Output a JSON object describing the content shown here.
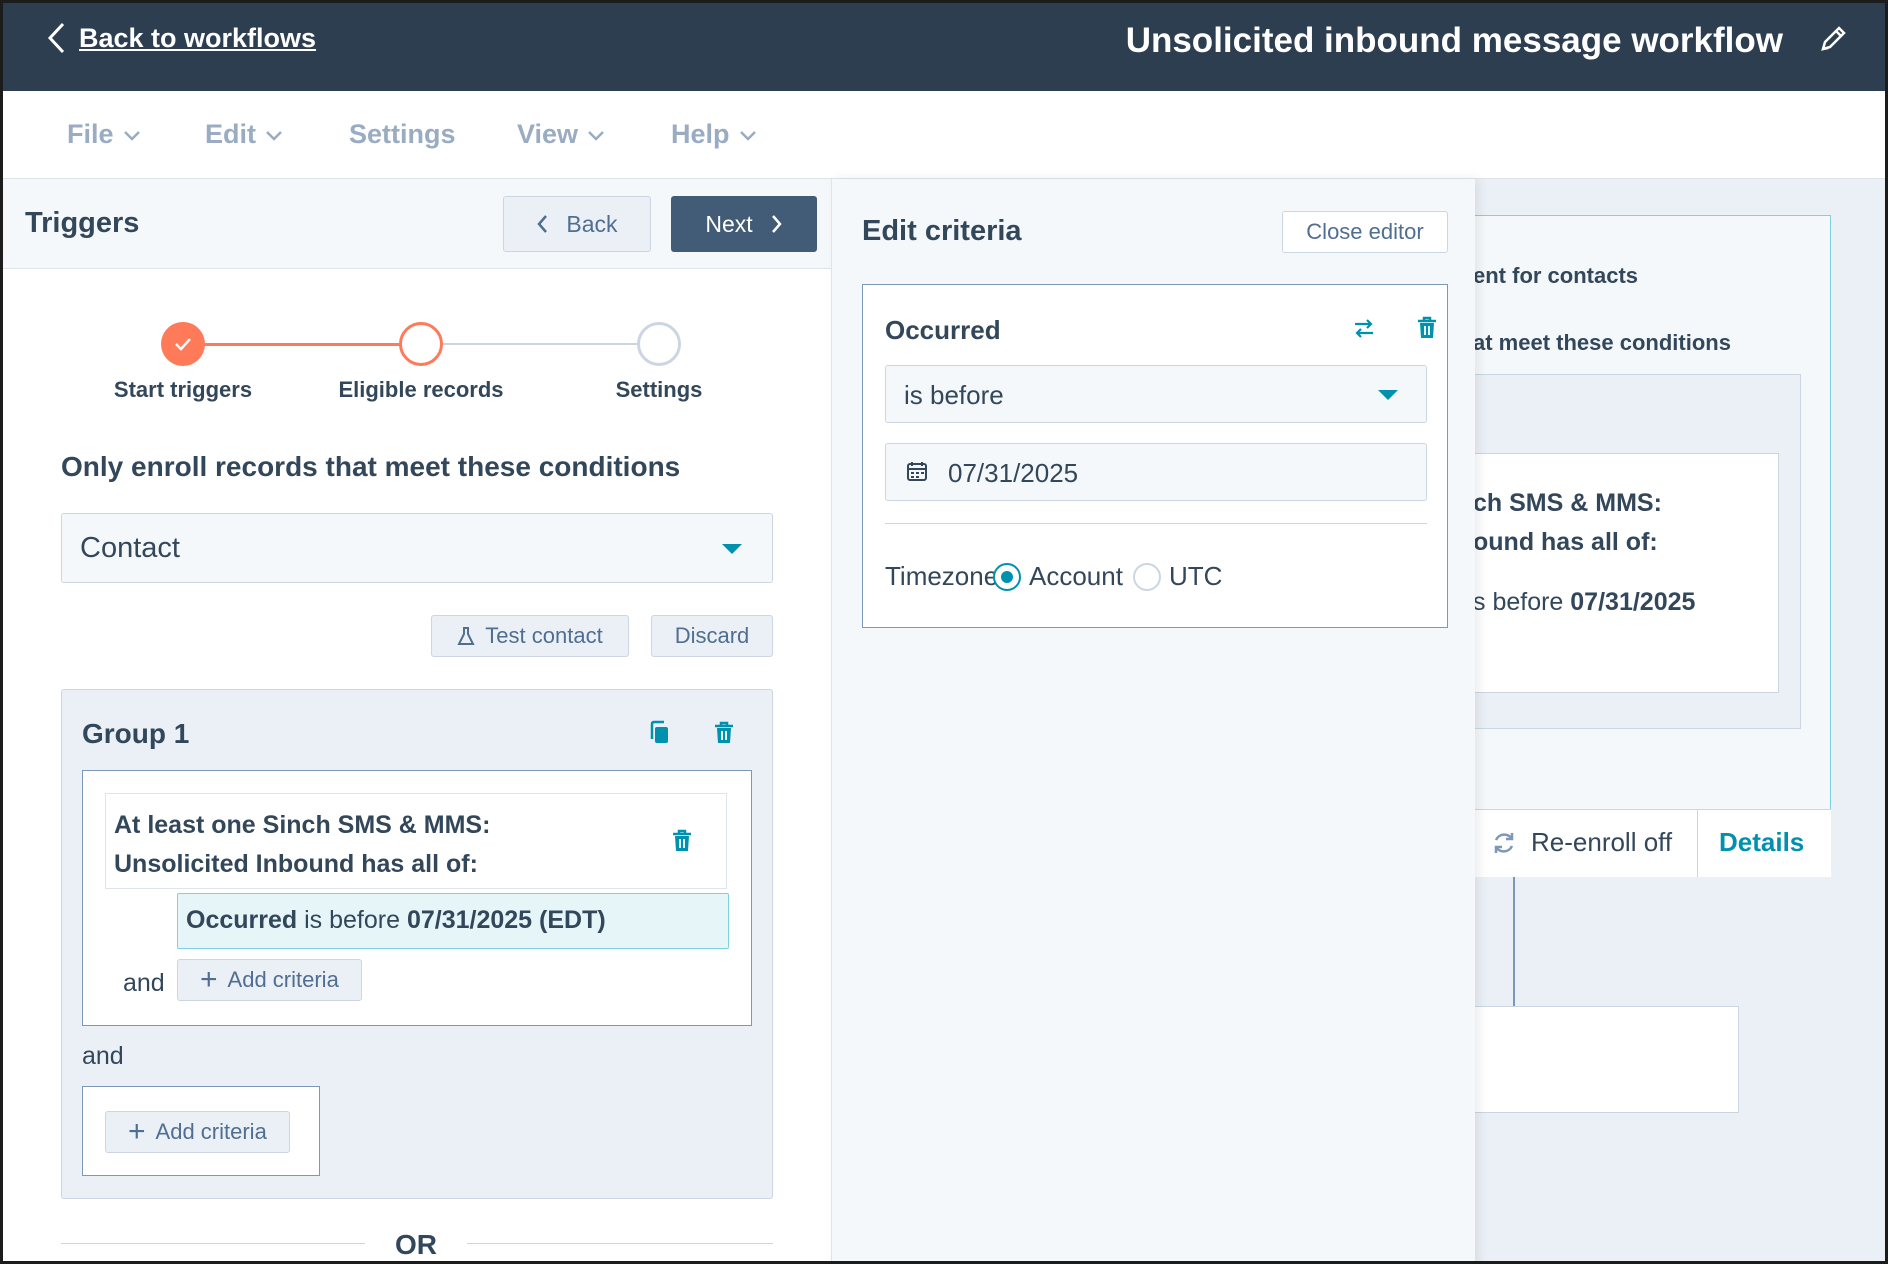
{
  "header": {
    "back_label": "Back to workflows",
    "workflow_title": "Unsolicited inbound message workflow"
  },
  "menu": [
    "File",
    "Edit",
    "Settings",
    "View",
    "Help"
  ],
  "triggers_panel": {
    "title": "Triggers",
    "back_label": "Back",
    "next_label": "Next",
    "steps": [
      "Start triggers",
      "Eligible records",
      "Settings"
    ],
    "heading": "Only enroll records that meet these conditions",
    "object_select": "Contact",
    "test_contact_label": "Test contact",
    "discard_label": "Discard",
    "group_title": "Group 1",
    "condition_line1": "At least one Sinch SMS & MMS:",
    "condition_line2": "Unsolicited Inbound has all of:",
    "criteria_property": "Occurred",
    "criteria_operator": "is before",
    "criteria_value": "07/31/2025 (EDT)",
    "and_label": "and",
    "add_criteria_label": "Add criteria",
    "or_label": "OR"
  },
  "edit_panel": {
    "title": "Edit criteria",
    "close_label": "Close editor",
    "property": "Occurred",
    "operator": "is before",
    "date_value": "07/31/2025",
    "timezone_label": "Timezone:",
    "timezone_options": [
      "Account",
      "UTC"
    ],
    "timezone_selected": "Account"
  },
  "background_card": {
    "line1": "ent for contacts",
    "line2": "at meet these conditions",
    "cond1": "ch SMS & MMS:",
    "cond2": "ound has all of:",
    "cond3_prefix": "s before ",
    "cond3_date": "07/31/2025",
    "reenroll_label": "Re-enroll off",
    "details_label": "Details"
  },
  "colors": {
    "header_bg": "#2d3e50",
    "accent_orange": "#ff7a59",
    "accent_teal": "#0091ae",
    "next_button": "#425b76"
  }
}
